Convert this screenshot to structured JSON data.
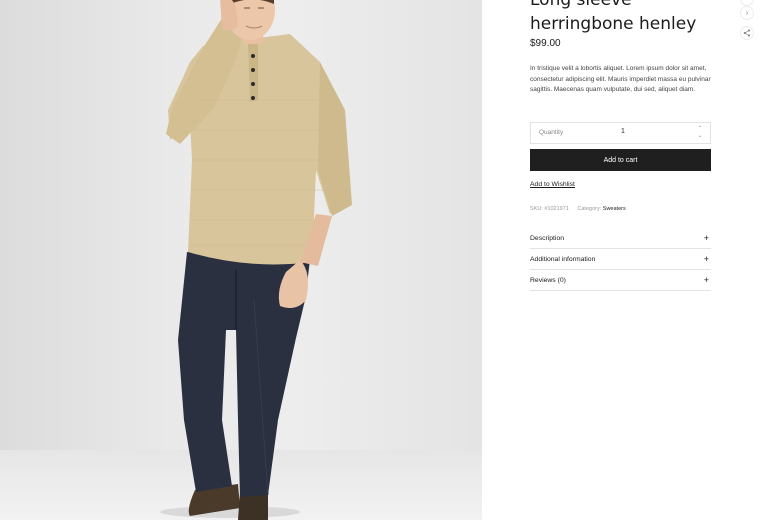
{
  "product": {
    "title": "Long sleeve herringbone henley",
    "price": "$99.00",
    "description": "In tristique velit a lobortis aliquet. Lorem ipsum dolor sit amet, consectetur adipiscing elit. Mauris imperdiet massa eu pulvinar sagittis. Maecenas quam vulputate, dui sed, aliquet diam."
  },
  "quantity": {
    "label": "Quantity",
    "value": "1",
    "up_glyph": "⌃",
    "down_glyph": "⌄"
  },
  "actions": {
    "add_to_cart": "Add to cart",
    "add_to_wishlist": "Add to Wishlist"
  },
  "meta": {
    "sku_label": "SKU:",
    "sku_value": "#1021971",
    "category_label": "Category:",
    "category_value": "Sweaters"
  },
  "accordion": [
    {
      "label": "Description",
      "icon": "+"
    },
    {
      "label": "Additional information",
      "icon": "+"
    },
    {
      "label": "Reviews (0)",
      "icon": "+"
    }
  ],
  "side_controls": {
    "next_glyph": "›",
    "share_glyph": "<"
  },
  "colors": {
    "button_bg": "#1f1f1f",
    "sweater": "#d9c59b",
    "jeans": "#2b3040",
    "background": "#e9e9e9"
  }
}
